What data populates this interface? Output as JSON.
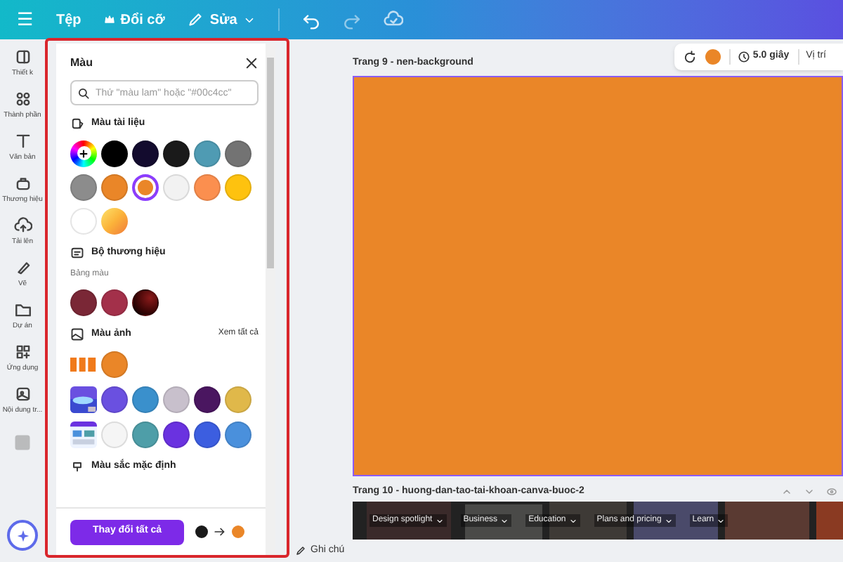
{
  "topbar": {
    "menu": [
      {
        "kind": "menu",
        "label": "☰"
      },
      {
        "kind": "file",
        "label": "Tệp"
      },
      {
        "kind": "resize",
        "label": "Đổi cỡ"
      },
      {
        "kind": "edit",
        "label": "Sửa"
      }
    ]
  },
  "sidebar": {
    "items": [
      {
        "kind": "template",
        "label": "Thiết k"
      },
      {
        "kind": "elements",
        "label": "Thành phần"
      },
      {
        "kind": "text",
        "label": "Văn bản"
      },
      {
        "kind": "brand",
        "label": "Thương hiệu"
      },
      {
        "kind": "upload",
        "label": "Tải lên"
      },
      {
        "kind": "draw",
        "label": "Vẽ"
      },
      {
        "kind": "project",
        "label": "Dự án"
      },
      {
        "kind": "apps",
        "label": "Ứng dụng"
      },
      {
        "kind": "content",
        "label": "Nội dung tr..."
      }
    ]
  },
  "color_panel": {
    "title": "Màu",
    "search": {
      "placeholder": "Thử \"màu lam\" hoặc \"#00c4cc\""
    },
    "document_colors": {
      "heading": "Màu tài liệu",
      "swatches": [
        {
          "kind": "add",
          "selected": false
        },
        {
          "color": "#000000",
          "selected": false
        },
        {
          "color": "#130b2e",
          "selected": false
        },
        {
          "color": "#1a1a1a",
          "selected": false
        },
        {
          "color": "#4f9bb3",
          "selected": false
        },
        {
          "color": "#737373",
          "selected": false
        },
        {
          "color": "#8c8c8c",
          "selected": false
        },
        {
          "color": "#ea8628",
          "selected": false
        },
        {
          "color": "#ea8628",
          "selected": true
        },
        {
          "color": "#f2f2f2",
          "selected": false
        },
        {
          "color": "#fb8f4f",
          "selected": false
        },
        {
          "color": "#fec20f",
          "selected": false
        },
        {
          "color": "#ffffff",
          "selected": false
        },
        {
          "kind": "gradient",
          "color": "#fbb33a",
          "selected": false
        }
      ]
    },
    "brand_kit": {
      "heading": "Bộ thương hiệu",
      "palette_label": "Bảng màu",
      "swatches": [
        {
          "color": "#7a2736"
        },
        {
          "color": "#a3304a"
        },
        {
          "color": "#3a0505"
        }
      ]
    },
    "photo_colors": {
      "heading": "Màu ảnh",
      "see_all": "Xem tất cả",
      "rows": [
        [
          {
            "kind": "picture"
          },
          {
            "color": "#ea8628"
          }
        ],
        [
          {
            "kind": "picture"
          },
          {
            "color": "#6a50e0"
          },
          {
            "color": "#3a90cc"
          },
          {
            "color": "#c8c0cc"
          },
          {
            "color": "#4a1660"
          },
          {
            "color": "#e0b84a"
          }
        ],
        [
          {
            "kind": "picture"
          },
          {
            "color": "#f5f5f5"
          },
          {
            "color": "#4e9ea8"
          },
          {
            "color": "#6a32e0"
          },
          {
            "color": "#3c5ee0"
          },
          {
            "color": "#4a90dc"
          }
        ]
      ]
    },
    "default_colors": {
      "heading": "Màu sắc mặc định"
    },
    "footer": {
      "button": "Thay đổi tất cả",
      "swatches": [
        {
          "color": "#1a1a1a"
        },
        {
          "color": "#ea8628"
        }
      ]
    }
  },
  "canvas": {
    "toolbar": {
      "color": "#ea8628",
      "duration": "5.0 giây",
      "position": "Vị trí"
    },
    "pages": [
      {
        "label": "Trang 9 - nen-background",
        "color": "#ea8628"
      },
      {
        "label": "Trang 10 - huong-dan-tao-tai-khoan-canva-buoc-2",
        "nav": [
          "Design spotlight",
          "Business",
          "Education",
          "Plans and pricing",
          "Learn"
        ]
      }
    ],
    "notes": "Ghi chú"
  }
}
